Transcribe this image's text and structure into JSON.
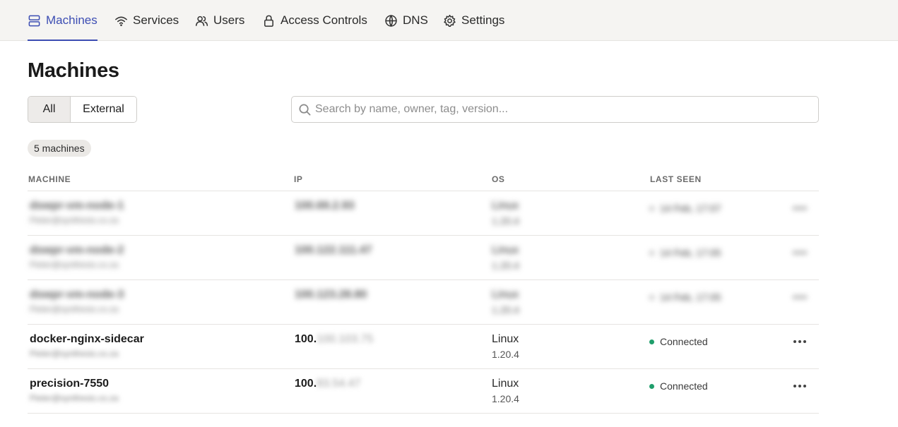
{
  "nav": {
    "items": [
      {
        "label": "Machines",
        "icon": "server-icon",
        "active": true
      },
      {
        "label": "Services",
        "icon": "wifi-icon"
      },
      {
        "label": "Users",
        "icon": "users-icon"
      },
      {
        "label": "Access Controls",
        "icon": "lock-icon"
      },
      {
        "label": "DNS",
        "icon": "globe-icon"
      },
      {
        "label": "Settings",
        "icon": "gear-icon"
      }
    ]
  },
  "page": {
    "title": "Machines"
  },
  "filters": {
    "all": "All",
    "external": "External",
    "selected": "All"
  },
  "search": {
    "placeholder": "Search by name, owner, tag, version..."
  },
  "count_badge": "5 machines",
  "table": {
    "headers": {
      "machine": "MACHINE",
      "ip": "IP",
      "os": "OS",
      "last_seen": "LAST SEEN"
    },
    "rows": [
      {
        "name": "dswpr-vm-node-1",
        "owner": "Pieter@synthesis.co.za",
        "ip": "100.69.2.93",
        "os": "Linux",
        "version": "1.20.4",
        "last_seen": "14 Feb, 17:07",
        "redacted": true
      },
      {
        "name": "dswpr-vm-node-2",
        "owner": "Pieter@synthesis.co.za",
        "ip": "100.122.111.47",
        "os": "Linux",
        "version": "1.20.4",
        "last_seen": "14 Feb, 17:05",
        "redacted": true
      },
      {
        "name": "dswpr-vm-node-3",
        "owner": "Pieter@synthesis.co.za",
        "ip": "100.123.28.80",
        "os": "Linux",
        "version": "1.20.4",
        "last_seen": "14 Feb, 17:05",
        "redacted": true
      },
      {
        "name": "docker-nginx-sidecar",
        "owner": "Pieter@synthesis.co.za",
        "ip_visible": "100.",
        "ip_masked": "100.103.75",
        "os": "Linux",
        "version": "1.20.4",
        "last_seen": "Connected",
        "status_color": "#1f9e6b"
      },
      {
        "name": "precision-7550",
        "owner": "Pieter@synthesis.co.za",
        "ip_visible": "100.",
        "ip_masked": "83.54.47",
        "os": "Linux",
        "version": "1.20.4",
        "last_seen": "Connected",
        "status_color": "#1f9e6b"
      }
    ]
  },
  "colors": {
    "accent": "#3c4db3",
    "connected": "#1f9e6b"
  }
}
